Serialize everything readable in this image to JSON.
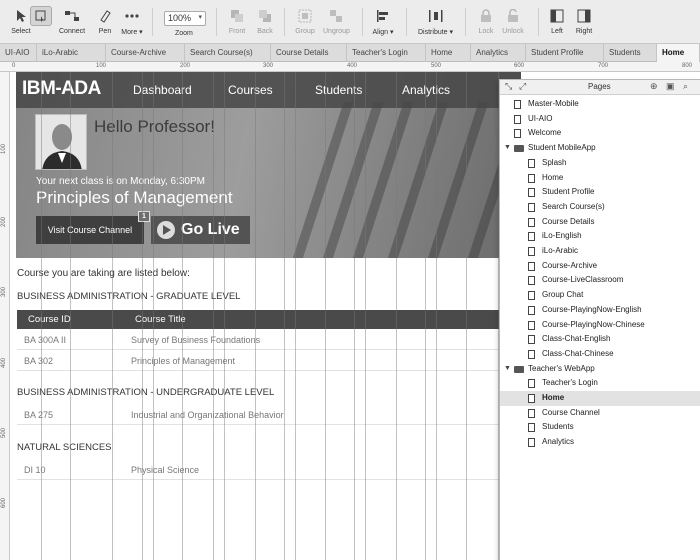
{
  "toolbar": {
    "tools": [
      "Select",
      "Connect",
      "Pen",
      "More ▾",
      "Zoom",
      "Front",
      "Back",
      "Group",
      "Ungroup",
      "Align ▾",
      "Distribute ▾",
      "Lock",
      "Unlock",
      "Left",
      "Right"
    ],
    "zoom_value": "100%"
  },
  "tabs": [
    "UI-AIO",
    "iLo-Arabic",
    "Course-Archive",
    "Search Course(s)",
    "Course Details",
    "Teacher's Login",
    "Home",
    "Analytics",
    "Student Profile",
    "Students",
    "Home"
  ],
  "ruler": {
    "top": [
      "0",
      "100",
      "200",
      "300",
      "400",
      "500",
      "600",
      "700",
      "800"
    ],
    "left": [
      "100",
      "200",
      "300",
      "400",
      "500",
      "600"
    ]
  },
  "hero": {
    "logo": "IBM-ADA",
    "nav": [
      "Dashboard",
      "Courses",
      "Students",
      "Analytics"
    ],
    "greeting": "Hello Professor!",
    "next_class": "Your next class is on Monday, 6:30PM",
    "course_title": "Principles of Management",
    "channel_button": "Visit Course Channel",
    "badge": "1",
    "live_button": "Go Live"
  },
  "content": {
    "intro": "Course you are taking are listed below:",
    "table_headers": [
      "Course ID",
      "Course Title"
    ],
    "sections": [
      {
        "title": "BUSINESS ADMINISTRATION - GRADUATE LEVEL",
        "rows": [
          {
            "id": "BA 300A II",
            "title": "Survey of Business Foundations"
          },
          {
            "id": "BA 302",
            "title": "Principles of Management"
          }
        ]
      },
      {
        "title": "BUSINESS ADMINISTRATION - UNDERGRADUATE LEVEL",
        "rows": [
          {
            "id": "BA 275",
            "title": "Industrial and Organizational Behavior"
          }
        ]
      },
      {
        "title": "NATURAL SCIENCES",
        "rows": [
          {
            "id": "DI 10",
            "title": "Physical Science"
          }
        ]
      }
    ]
  },
  "pages_panel": {
    "title": "Pages",
    "items": [
      {
        "label": "Master-Mobile",
        "type": "page",
        "level": 0
      },
      {
        "label": "UI-AIO",
        "type": "page",
        "level": 0
      },
      {
        "label": "Welcome",
        "type": "page",
        "level": 0
      },
      {
        "label": "Student MobileApp",
        "type": "folder",
        "level": 0
      },
      {
        "label": "Splash",
        "type": "page",
        "level": 1
      },
      {
        "label": "Home",
        "type": "page",
        "level": 1
      },
      {
        "label": "Student Profile",
        "type": "page",
        "level": 1
      },
      {
        "label": "Search Course(s)",
        "type": "page",
        "level": 1
      },
      {
        "label": "Course Details",
        "type": "page",
        "level": 1
      },
      {
        "label": "iLo-English",
        "type": "page",
        "level": 1
      },
      {
        "label": "iLo-Arabic",
        "type": "page",
        "level": 1
      },
      {
        "label": "Course-Archive",
        "type": "page",
        "level": 1
      },
      {
        "label": "Course-LiveClassroom",
        "type": "page",
        "level": 1
      },
      {
        "label": "Group Chat",
        "type": "page",
        "level": 1
      },
      {
        "label": "Course-PlayingNow-English",
        "type": "page",
        "level": 1
      },
      {
        "label": "Course-PlayingNow-Chinese",
        "type": "page",
        "level": 1
      },
      {
        "label": "Class-Chat-English",
        "type": "page",
        "level": 1
      },
      {
        "label": "Class-Chat-Chinese",
        "type": "page",
        "level": 1
      },
      {
        "label": "Teacher's WebApp",
        "type": "folder",
        "level": 0
      },
      {
        "label": "Teacher's Login",
        "type": "page",
        "level": 1
      },
      {
        "label": "Home",
        "type": "page",
        "level": 1,
        "active": true
      },
      {
        "label": "Course Channel",
        "type": "page",
        "level": 1
      },
      {
        "label": "Students",
        "type": "page",
        "level": 1
      },
      {
        "label": "Analytics",
        "type": "page",
        "level": 1
      }
    ]
  }
}
